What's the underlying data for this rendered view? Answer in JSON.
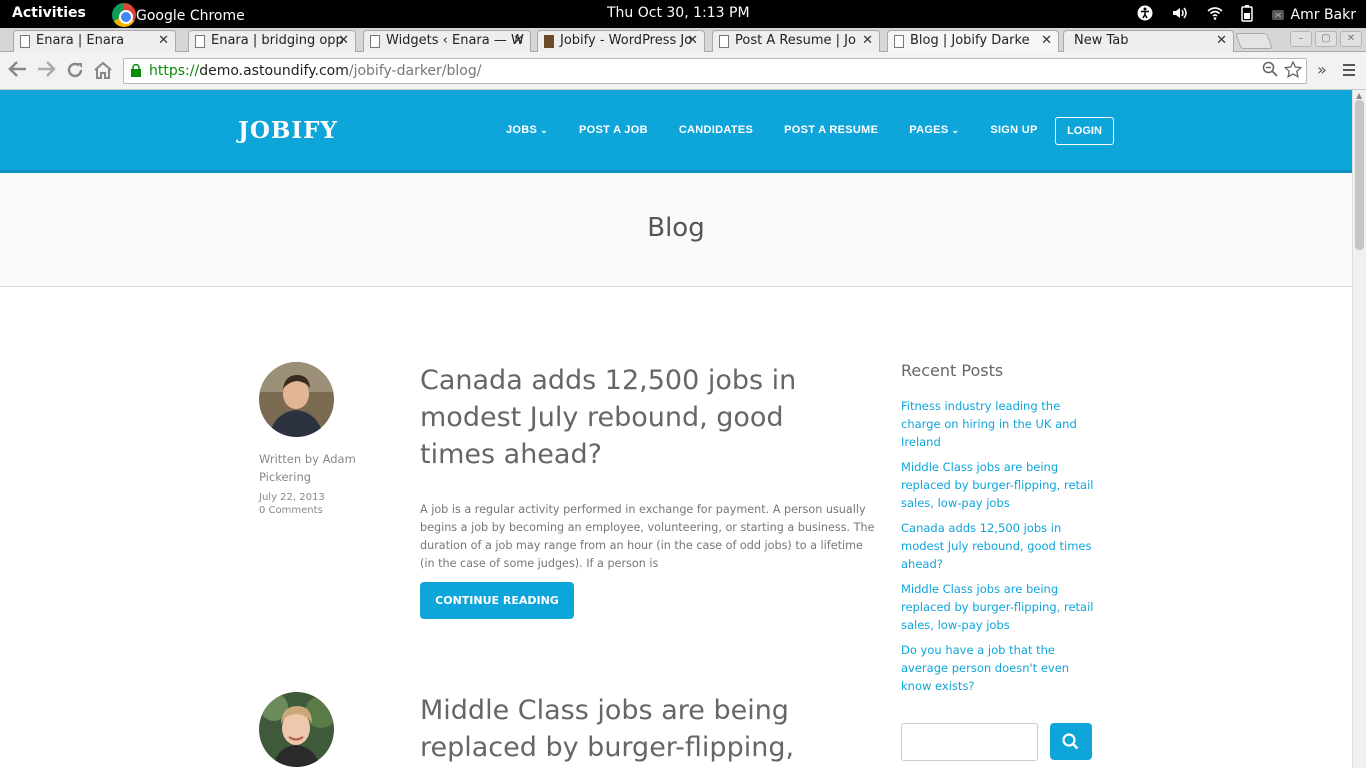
{
  "system_bar": {
    "activities": "Activities",
    "app_name": "Google Chrome",
    "clock": "Thu Oct 30,  1:13 PM",
    "user": "Amr Bakr"
  },
  "browser": {
    "tabs": [
      {
        "title": "Enara | Enara"
      },
      {
        "title": "Enara | bridging opp"
      },
      {
        "title": "Widgets ‹ Enara — W"
      },
      {
        "title": "Jobify - WordPress Jo"
      },
      {
        "title": "Post A Resume | Jo"
      },
      {
        "title": "Blog | Jobify Darke"
      },
      {
        "title": "New Tab"
      }
    ],
    "url_scheme": "https://",
    "url_host": "demo.astoundify.com",
    "url_path": "/jobify-darker/blog/"
  },
  "site": {
    "logo": "JOBIFY",
    "nav": {
      "jobs": "JOBS",
      "post_job": "POST A JOB",
      "candidates": "CANDIDATES",
      "post_resume": "POST A RESUME",
      "pages": "PAGES",
      "sign_up": "SIGN UP",
      "login": "LOGIN"
    },
    "page_title": "Blog"
  },
  "posts": [
    {
      "title": "Canada adds 12,500 jobs in modest July rebound, good times ahead?",
      "author": "Written by Adam Pickering",
      "date": "July 22, 2013",
      "comments": "0 Comments",
      "excerpt": "A job is a regular activity performed in exchange for payment. A person usually begins a job by becoming an employee, volunteering, or starting a business. The duration of a job may range from an hour (in the case of odd jobs) to a lifetime (in the case of some judges). If a person is",
      "cta": "CONTINUE READING"
    },
    {
      "title": "Middle Class jobs are being replaced by burger-flipping,"
    }
  ],
  "sidebar": {
    "recent_heading": "Recent Posts",
    "recent_posts": [
      "Fitness industry leading the charge on hiring in the UK and Ireland",
      "Middle Class jobs are being replaced by burger-flipping, retail sales, low-pay jobs",
      "Canada adds 12,500 jobs in modest July rebound, good times ahead?",
      "Middle Class jobs are being replaced by burger-flipping, retail sales, low-pay jobs",
      "Do you have a job that the average person doesn't even know exists?"
    ]
  },
  "colors": {
    "brand": "#0ea5db",
    "title_text": "#666666"
  }
}
